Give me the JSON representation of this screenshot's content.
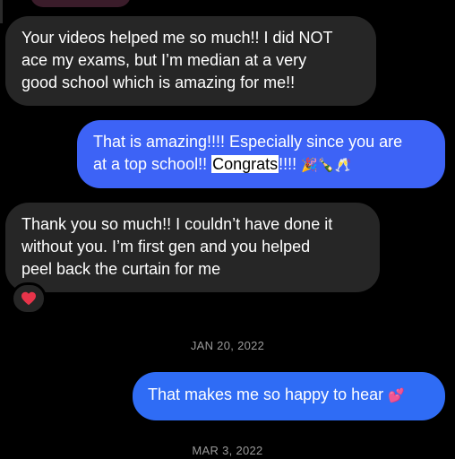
{
  "messages": [
    {
      "direction": "incoming",
      "lines": [
        "Your videos helped me so much!! I did NOT",
        "ace my exams, but I’m median at a very",
        "good school which is amazing for me!!"
      ]
    },
    {
      "direction": "outgoing",
      "line1": "That is amazing!!!! Especially since you are",
      "line2_before": "at a top school!! ",
      "line2_highlight": "Congrats",
      "line2_after": "!!!! ",
      "line2_emoji": "🎉🍾🥂"
    },
    {
      "direction": "incoming",
      "lines": [
        "Thank you so much!! I couldn’t have done it",
        "without you. I’m first gen and you helped",
        "peel back the curtain for me"
      ],
      "reaction": "❤️"
    },
    {
      "direction": "outgoing",
      "text": "That makes me so happy to hear",
      "emoji": "💕"
    }
  ],
  "dates": [
    "JAN 20, 2022",
    "MAR 3, 2022"
  ],
  "colors": {
    "background": "#000000",
    "incoming_bubble": "#262626",
    "outgoing_bubble": "#3d63f6",
    "date_text": "#9a9a9a",
    "heart": "#e8344a"
  }
}
